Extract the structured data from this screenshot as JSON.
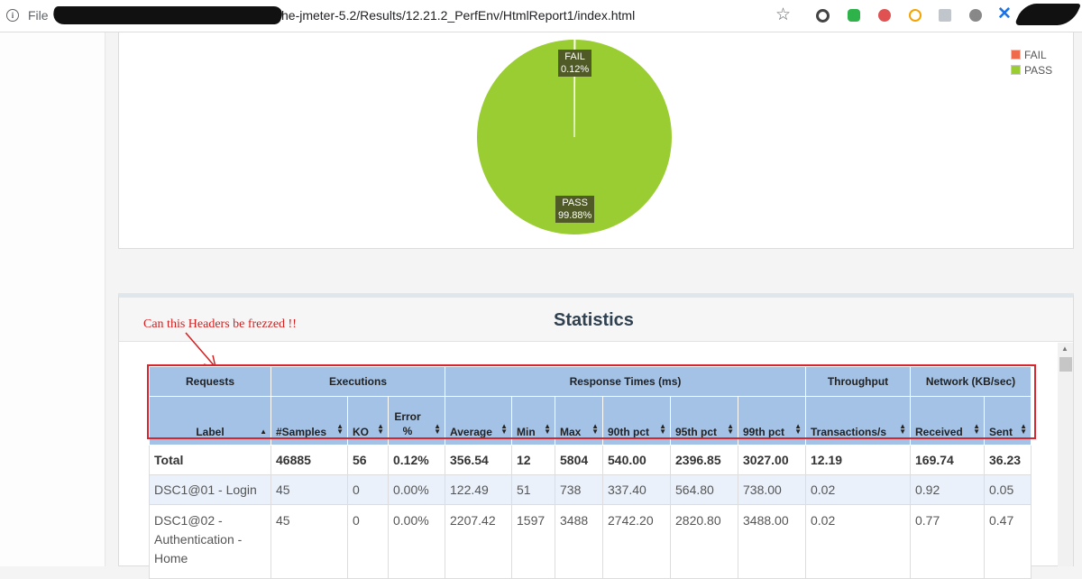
{
  "browser": {
    "scheme_label": "File",
    "url_visible": "he-jmeter-5.2/Results/12.21.2_PerfEnv/HtmlReport1/index.html"
  },
  "pie": {
    "labels": [
      {
        "name": "FAIL",
        "pct": "0.12%"
      },
      {
        "name": "PASS",
        "pct": "99.88%"
      }
    ],
    "legend": [
      "FAIL",
      "PASS"
    ],
    "colors": {
      "FAIL": "#ee6a4a",
      "PASS": "#9acd32"
    }
  },
  "chart_data": {
    "type": "pie",
    "categories": [
      "FAIL",
      "PASS"
    ],
    "values": [
      0.12,
      99.88
    ],
    "legend_position": "top-right"
  },
  "statistics": {
    "title": "Statistics",
    "annotation": "Can this Headers be frezzed !!",
    "groups": [
      "Requests",
      "Executions",
      "Response Times (ms)",
      "Throughput",
      "Network (KB/sec)"
    ],
    "columns": [
      "Label",
      "#Samples",
      "KO",
      "Error %",
      "Average",
      "Min",
      "Max",
      "90th pct",
      "95th pct",
      "99th pct",
      "Transactions/s",
      "Received",
      "Sent"
    ],
    "rows": [
      [
        "Total",
        "46885",
        "56",
        "0.12%",
        "356.54",
        "12",
        "5804",
        "540.00",
        "2396.85",
        "3027.00",
        "12.19",
        "169.74",
        "36.23"
      ],
      [
        "DSC1@01 - Login",
        "45",
        "0",
        "0.00%",
        "122.49",
        "51",
        "738",
        "337.40",
        "564.80",
        "738.00",
        "0.02",
        "0.92",
        "0.05"
      ],
      [
        "DSC1@02 - Authentication - Home",
        "45",
        "0",
        "0.00%",
        "2207.42",
        "1597",
        "3488",
        "2742.20",
        "2820.80",
        "3488.00",
        "0.02",
        "0.77",
        "0.47"
      ]
    ]
  }
}
